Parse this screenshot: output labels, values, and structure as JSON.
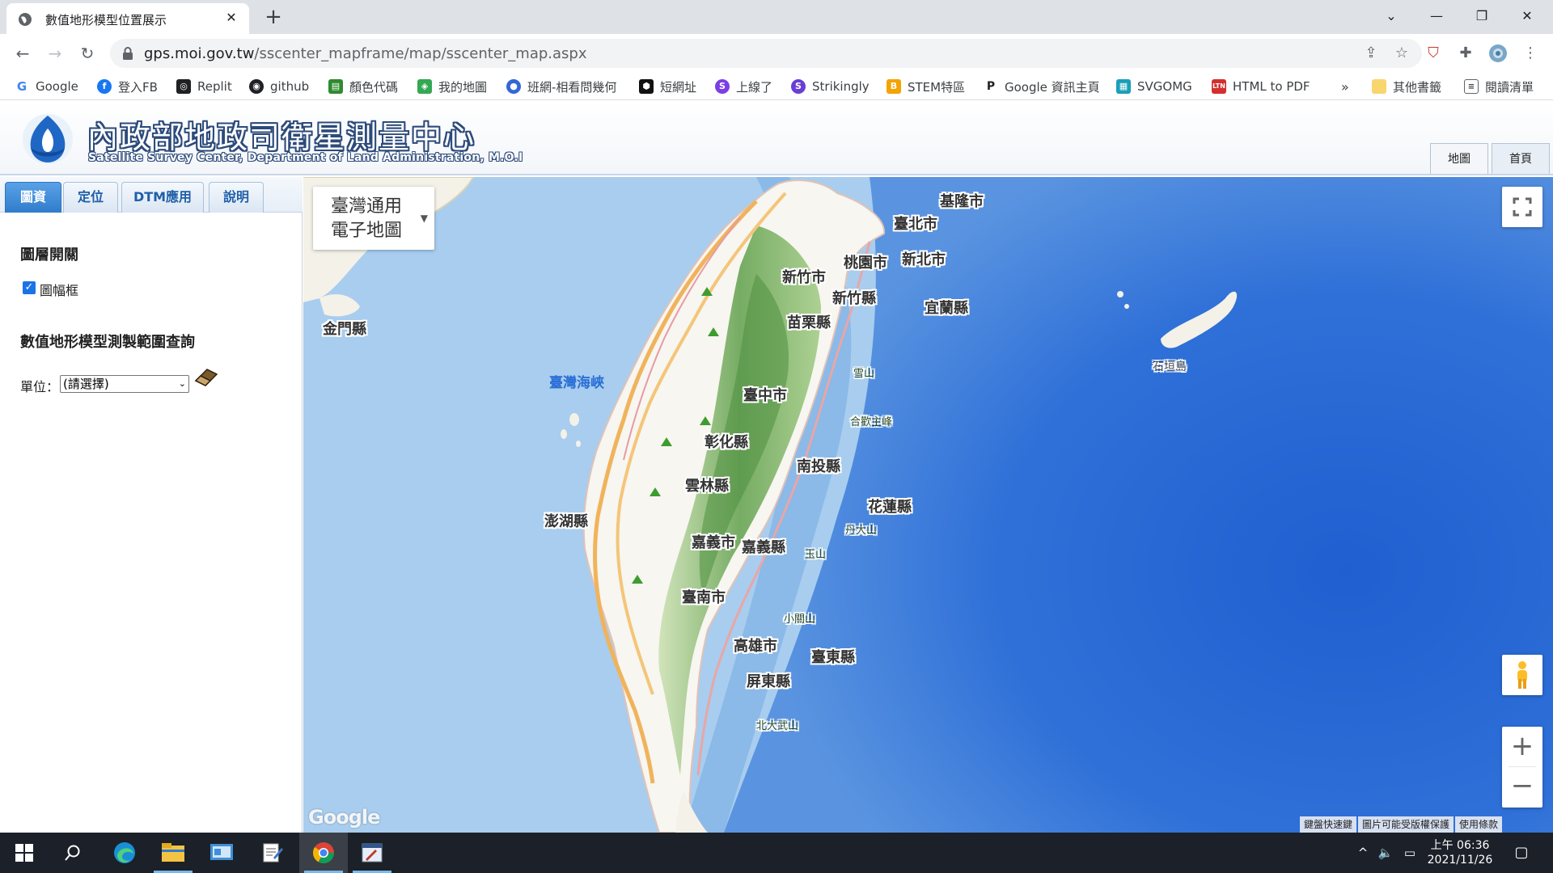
{
  "browser": {
    "tab_title": "數值地形模型位置展示",
    "url_host": "gps.moi.gov.tw",
    "url_path": "/sscenter_mapframe/map/sscenter_map.aspx",
    "bookmarks": [
      {
        "label": "Google",
        "icon": "google-icon",
        "color": "#4285f4"
      },
      {
        "label": "登入FB",
        "icon": "facebook-icon",
        "color": "#1877f2"
      },
      {
        "label": "Replit",
        "icon": "replit-icon",
        "color": "#202124"
      },
      {
        "label": "github",
        "icon": "github-icon",
        "color": "#202124"
      },
      {
        "label": "顏色代碼",
        "icon": "color-icon",
        "color": "#2e8b2e"
      },
      {
        "label": "我的地圖",
        "icon": "maps-icon",
        "color": "#34a853"
      },
      {
        "label": "班網-相看問幾何",
        "icon": "class-icon",
        "color": "#3367d6"
      },
      {
        "label": "短網址",
        "icon": "short-url-icon",
        "color": "#111111"
      },
      {
        "label": "上線了",
        "icon": "s-icon",
        "color": "#7b3fe4"
      },
      {
        "label": "Strikingly",
        "icon": "strikingly-icon",
        "color": "#6a3fd4"
      },
      {
        "label": "STEM特區",
        "icon": "stem-icon",
        "color": "#f4a300"
      },
      {
        "label": "Google 資訊主頁",
        "icon": "p-icon",
        "color": "#202124"
      },
      {
        "label": "SVGOMG",
        "icon": "svgomg-icon",
        "color": "#1aa0b8"
      },
      {
        "label": "HTML to PDF",
        "icon": "pdf-icon",
        "color": "#d32f2f"
      }
    ],
    "bookmarks_overflow": "»",
    "other_bookmarks": "其他書籤",
    "reading_list": "閱讀清單"
  },
  "site": {
    "title": "內政部地政司衛星測量中心",
    "subtitle": "Satellite Survey Center, Department of Land Administration, M.O.I",
    "nav": [
      "地圖",
      "首頁"
    ]
  },
  "panel": {
    "tabs": [
      "圖資",
      "定位",
      "DTM應用",
      "說明"
    ],
    "active_tab": "圖資",
    "layer_heading": "圖層開關",
    "frame_label": "圖幅框",
    "frame_checked": true,
    "dtm_heading": "數值地形模型測製範圍查詢",
    "unit_label": "單位：",
    "unit_select_value": "(請選擇)"
  },
  "map": {
    "type_selector": "臺灣通用電子地圖",
    "type_line1": "臺灣通用",
    "type_line2": "電子地圖",
    "labels": {
      "keelung": "基隆市",
      "taipei": "臺北市",
      "taoyuan": "桃園市",
      "new_taipei": "新北市",
      "hsinchu_city": "新竹市",
      "hsinchu_county": "新竹縣",
      "yilan": "宜蘭縣",
      "miaoli": "苗栗縣",
      "taichung": "臺中市",
      "changhua": "彰化縣",
      "nantou": "南投縣",
      "yunlin": "雲林縣",
      "hualien": "花蓮縣",
      "chiayi_city": "嘉義市",
      "chiayi_county": "嘉義縣",
      "tainan": "臺南市",
      "kaohsiung": "高雄市",
      "taitung": "臺東縣",
      "pingtung": "屏東縣",
      "kinmen": "金門縣",
      "penghu": "澎湖縣",
      "strait": "臺灣海峽",
      "ishigaki": "石垣島",
      "xueshan": "雪山",
      "hehuan": "合歡主峰",
      "dandashan": "丹大山",
      "yushan": "玉山",
      "xiaoguanshan": "小關山",
      "beidawu": "北大武山"
    },
    "google_logo": "Google",
    "attribution": [
      "鍵盤快速鍵",
      "圖片可能受版權保護",
      "使用條款"
    ]
  },
  "taskbar": {
    "time": "上午 06:36",
    "date": "2021/11/26"
  },
  "colors": {
    "ocean_deep": "#2f6fd8",
    "ocean_shallow": "#a9cdee",
    "land_low": "#f7f7f2",
    "mountain": "#7fb36a",
    "tab_active": "#2f7ccc"
  }
}
